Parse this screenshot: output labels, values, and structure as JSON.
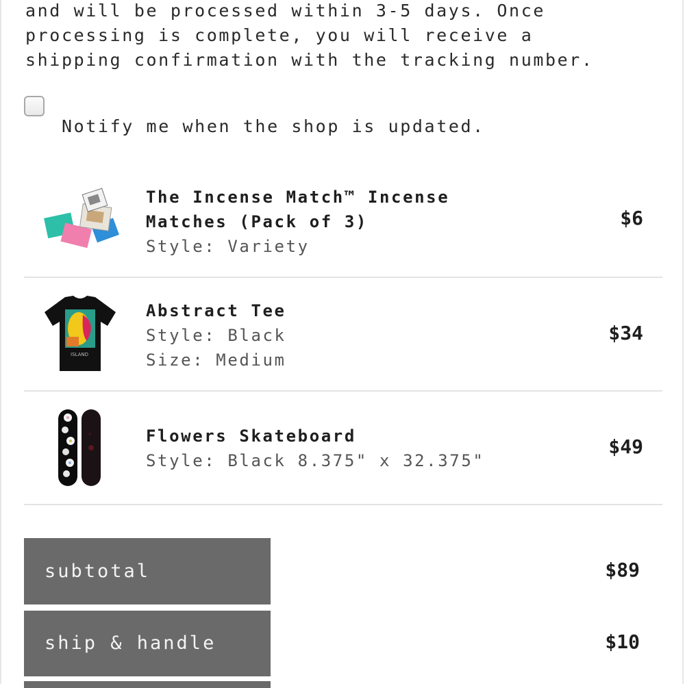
{
  "intro_text": "and will be processed within 3-5 days. Once\nprocessing is complete, you will receive a\nshipping confirmation with the tracking number.",
  "notify": {
    "label": "Notify me when the shop is updated.",
    "checked": false
  },
  "items": [
    {
      "name_line1": "The Incense Match™ Incense",
      "name_line2": "Matches (Pack of 3)",
      "style": "Style: Variety",
      "price": "$6",
      "thumb_icon": "incense-matches-thumbnail"
    },
    {
      "name": "Abstract Tee",
      "style": "Style: Black",
      "size": "Size: Medium",
      "price": "$34",
      "thumb_icon": "black-tshirt-thumbnail"
    },
    {
      "name": "Flowers Skateboard",
      "style": "Style: Black 8.375\" x 32.375\"",
      "price": "$49",
      "thumb_icon": "skateboard-thumbnail"
    }
  ],
  "summary": {
    "subtotal_label": "subtotal",
    "subtotal_value": "$89",
    "shipping_label": "ship & handle",
    "shipping_value": "$10"
  }
}
